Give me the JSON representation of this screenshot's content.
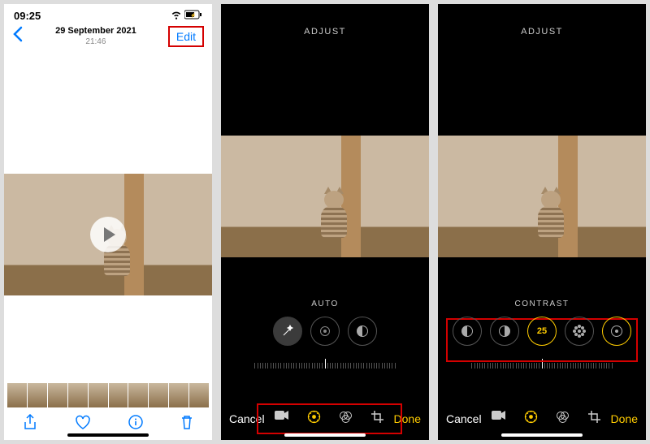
{
  "detail": {
    "status_time": "09:25",
    "wifi_icon": "wifi",
    "battery_icon": "battery-charging",
    "date": "29 September 2021",
    "time": "21:46",
    "back_icon": "chevron-left",
    "edit_label": "Edit",
    "play_icon": "play",
    "toolbar": {
      "share_icon": "share",
      "favorite_icon": "heart",
      "info_icon": "info",
      "trash_icon": "trash"
    }
  },
  "editor_auto": {
    "header": "ADJUST",
    "mode_label": "AUTO",
    "knobs": [
      {
        "icon": "wand",
        "selected": true,
        "filled": true
      },
      {
        "icon": "exposure",
        "selected": false
      },
      {
        "icon": "contrast",
        "selected": false
      }
    ],
    "bottom": {
      "cancel": "Cancel",
      "done": "Done",
      "tools": {
        "video_icon": "video",
        "adjust_icon": "adjust-dial",
        "filters_icon": "filters",
        "crop_icon": "crop",
        "active": "adjust-dial"
      }
    }
  },
  "editor_contrast": {
    "header": "ADJUST",
    "mode_label": "CONTRAST",
    "value": "25",
    "knobs": [
      {
        "icon": "exposure"
      },
      {
        "icon": "contrast"
      },
      {
        "icon": "value",
        "text": "25",
        "selected": true
      },
      {
        "icon": "brightness"
      },
      {
        "icon": "vignette"
      }
    ],
    "bottom": {
      "cancel": "Cancel",
      "done": "Done",
      "tools": {
        "video_icon": "video",
        "adjust_icon": "adjust-dial",
        "filters_icon": "filters",
        "crop_icon": "crop",
        "active": "adjust-dial"
      }
    }
  },
  "colors": {
    "ios_blue": "#007aff",
    "ios_yellow": "#ffcc00",
    "highlight_red": "#d40000"
  }
}
